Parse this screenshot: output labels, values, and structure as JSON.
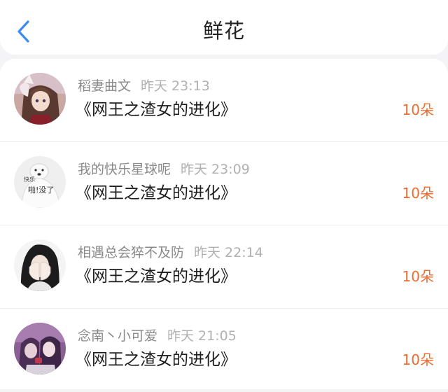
{
  "header": {
    "title": "鲜花",
    "back_icon": "chevron-left-icon",
    "accent_color": "#3d8bf2"
  },
  "count_color": "#f06a2c",
  "list": [
    {
      "username": "稻妻曲文",
      "time": "昨天 23:13",
      "book": "《网王之渣女的进化》",
      "count": "10朵",
      "avatar": "anime-girl-avatar"
    },
    {
      "username": "我的快乐星球呢",
      "time": "昨天 23:09",
      "book": "《网王之渣女的进化》",
      "count": "10朵",
      "avatar": "dog-meme-avatar"
    },
    {
      "username": "相遇总会猝不及防",
      "time": "昨天 22:14",
      "book": "《网王之渣女的进化》",
      "count": "10朵",
      "avatar": "girl-covering-face-avatar"
    },
    {
      "username": "念南丶小可爱",
      "time": "昨天 21:05",
      "book": "《网王之渣女的进化》",
      "count": "10朵",
      "avatar": "anime-pair-avatar"
    }
  ]
}
